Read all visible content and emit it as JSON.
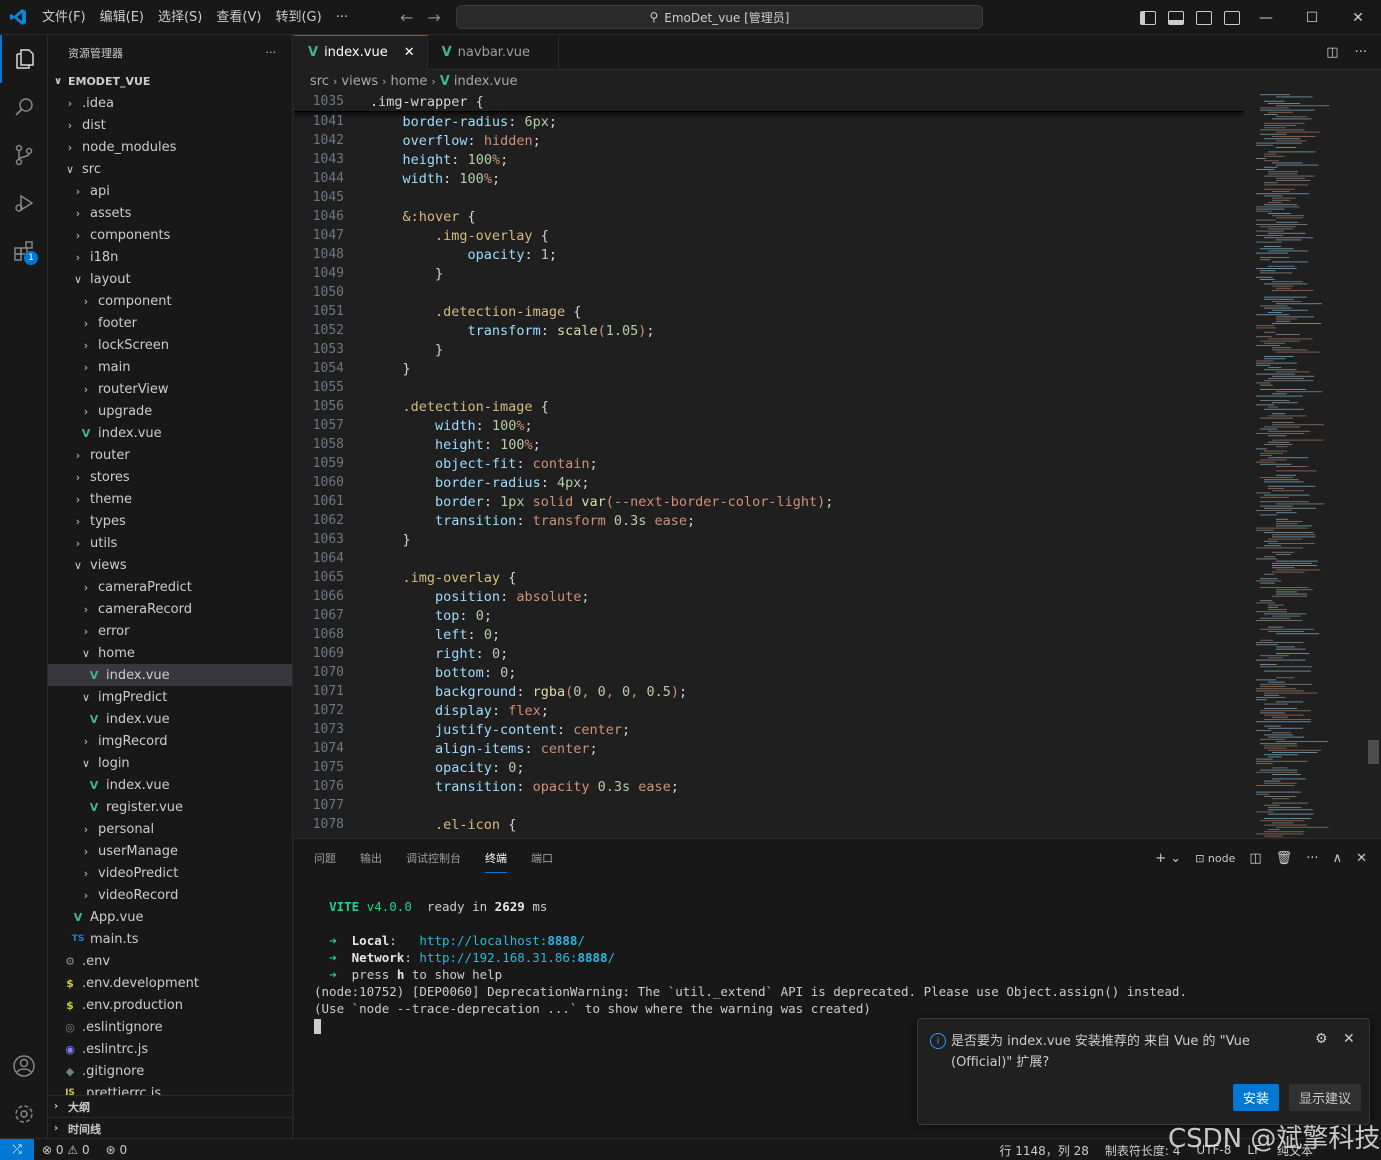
{
  "titlebar": {
    "menus": [
      "文件(F)",
      "编辑(E)",
      "选择(S)",
      "查看(V)",
      "转到(G)",
      "···"
    ],
    "command_center": "EmoDet_vue [管理员]"
  },
  "sidebar": {
    "title": "资源管理器",
    "more": "···",
    "root": "EMODET_VUE",
    "tree": [
      {
        "label": ".idea",
        "depth": 0,
        "kind": "folder",
        "open": false
      },
      {
        "label": "dist",
        "depth": 0,
        "kind": "folder",
        "open": false
      },
      {
        "label": "node_modules",
        "depth": 0,
        "kind": "folder",
        "open": false
      },
      {
        "label": "src",
        "depth": 0,
        "kind": "folder",
        "open": true
      },
      {
        "label": "api",
        "depth": 1,
        "kind": "folder",
        "open": false
      },
      {
        "label": "assets",
        "depth": 1,
        "kind": "folder",
        "open": false
      },
      {
        "label": "components",
        "depth": 1,
        "kind": "folder",
        "open": false
      },
      {
        "label": "i18n",
        "depth": 1,
        "kind": "folder",
        "open": false
      },
      {
        "label": "layout",
        "depth": 1,
        "kind": "folder",
        "open": true
      },
      {
        "label": "component",
        "depth": 2,
        "kind": "folder",
        "open": false
      },
      {
        "label": "footer",
        "depth": 2,
        "kind": "folder",
        "open": false
      },
      {
        "label": "lockScreen",
        "depth": 2,
        "kind": "folder",
        "open": false
      },
      {
        "label": "main",
        "depth": 2,
        "kind": "folder",
        "open": false
      },
      {
        "label": "routerView",
        "depth": 2,
        "kind": "folder",
        "open": false
      },
      {
        "label": "upgrade",
        "depth": 2,
        "kind": "folder",
        "open": false
      },
      {
        "label": "index.vue",
        "depth": 2,
        "kind": "vue"
      },
      {
        "label": "router",
        "depth": 1,
        "kind": "folder",
        "open": false
      },
      {
        "label": "stores",
        "depth": 1,
        "kind": "folder",
        "open": false
      },
      {
        "label": "theme",
        "depth": 1,
        "kind": "folder",
        "open": false
      },
      {
        "label": "types",
        "depth": 1,
        "kind": "folder",
        "open": false
      },
      {
        "label": "utils",
        "depth": 1,
        "kind": "folder",
        "open": false
      },
      {
        "label": "views",
        "depth": 1,
        "kind": "folder",
        "open": true
      },
      {
        "label": "cameraPredict",
        "depth": 2,
        "kind": "folder",
        "open": false
      },
      {
        "label": "cameraRecord",
        "depth": 2,
        "kind": "folder",
        "open": false
      },
      {
        "label": "error",
        "depth": 2,
        "kind": "folder",
        "open": false
      },
      {
        "label": "home",
        "depth": 2,
        "kind": "folder",
        "open": true
      },
      {
        "label": "index.vue",
        "depth": 3,
        "kind": "vue",
        "selected": true
      },
      {
        "label": "imgPredict",
        "depth": 2,
        "kind": "folder",
        "open": true
      },
      {
        "label": "index.vue",
        "depth": 3,
        "kind": "vue"
      },
      {
        "label": "imgRecord",
        "depth": 2,
        "kind": "folder",
        "open": false
      },
      {
        "label": "login",
        "depth": 2,
        "kind": "folder",
        "open": true
      },
      {
        "label": "index.vue",
        "depth": 3,
        "kind": "vue"
      },
      {
        "label": "register.vue",
        "depth": 3,
        "kind": "vue"
      },
      {
        "label": "personal",
        "depth": 2,
        "kind": "folder",
        "open": false
      },
      {
        "label": "userManage",
        "depth": 2,
        "kind": "folder",
        "open": false
      },
      {
        "label": "videoPredict",
        "depth": 2,
        "kind": "folder",
        "open": false
      },
      {
        "label": "videoRecord",
        "depth": 2,
        "kind": "folder",
        "open": false
      },
      {
        "label": "App.vue",
        "depth": 1,
        "kind": "vue"
      },
      {
        "label": "main.ts",
        "depth": 1,
        "kind": "ts"
      },
      {
        "label": ".env",
        "depth": 0,
        "kind": "gear"
      },
      {
        "label": ".env.development",
        "depth": 0,
        "kind": "dollar"
      },
      {
        "label": ".env.production",
        "depth": 0,
        "kind": "dollar"
      },
      {
        "label": ".eslintignore",
        "depth": 0,
        "kind": "eslintignore"
      },
      {
        "label": ".eslintrc.js",
        "depth": 0,
        "kind": "eslint"
      },
      {
        "label": ".gitignore",
        "depth": 0,
        "kind": "git"
      },
      {
        "label": ".prettierrc.js",
        "depth": 0,
        "kind": "js"
      }
    ],
    "outline": "大纲",
    "timeline": "时间线"
  },
  "icons": {
    "tree_file_glyphs": {
      "vue": "V",
      "ts": "TS",
      "gear": "⚙",
      "dollar": "$",
      "eslintignore": "◎",
      "eslint": "◉",
      "git": "◆",
      "js": "JS"
    }
  },
  "editor": {
    "tabs": [
      {
        "label": "index.vue",
        "active": true
      },
      {
        "label": "navbar.vue",
        "active": false
      }
    ],
    "breadcrumb": [
      "src",
      "views",
      "home",
      "index.vue"
    ],
    "sticky": {
      "num": "1035",
      "code": ".img-wrapper {"
    },
    "lines": [
      {
        "num": "1041",
        "code": "    border-radius: 6px;"
      },
      {
        "num": "1042",
        "code": "    overflow: hidden;"
      },
      {
        "num": "1043",
        "code": "    height: 100%;"
      },
      {
        "num": "1044",
        "code": "    width: 100%;"
      },
      {
        "num": "1045",
        "code": ""
      },
      {
        "num": "1046",
        "code": "    &:hover {"
      },
      {
        "num": "1047",
        "code": "        .img-overlay {"
      },
      {
        "num": "1048",
        "code": "            opacity: 1;"
      },
      {
        "num": "1049",
        "code": "        }"
      },
      {
        "num": "1050",
        "code": ""
      },
      {
        "num": "1051",
        "code": "        .detection-image {"
      },
      {
        "num": "1052",
        "code": "            transform: scale(1.05);"
      },
      {
        "num": "1053",
        "code": "        }"
      },
      {
        "num": "1054",
        "code": "    }"
      },
      {
        "num": "1055",
        "code": ""
      },
      {
        "num": "1056",
        "code": "    .detection-image {"
      },
      {
        "num": "1057",
        "code": "        width: 100%;"
      },
      {
        "num": "1058",
        "code": "        height: 100%;"
      },
      {
        "num": "1059",
        "code": "        object-fit: contain;"
      },
      {
        "num": "1060",
        "code": "        border-radius: 4px;"
      },
      {
        "num": "1061",
        "code": "        border: 1px solid var(--next-border-color-light);"
      },
      {
        "num": "1062",
        "code": "        transition: transform 0.3s ease;"
      },
      {
        "num": "1063",
        "code": "    }"
      },
      {
        "num": "1064",
        "code": ""
      },
      {
        "num": "1065",
        "code": "    .img-overlay {"
      },
      {
        "num": "1066",
        "code": "        position: absolute;"
      },
      {
        "num": "1067",
        "code": "        top: 0;"
      },
      {
        "num": "1068",
        "code": "        left: 0;"
      },
      {
        "num": "1069",
        "code": "        right: 0;"
      },
      {
        "num": "1070",
        "code": "        bottom: 0;"
      },
      {
        "num": "1071",
        "code": "        background: rgba(0, 0, 0, 0.5);"
      },
      {
        "num": "1072",
        "code": "        display: flex;"
      },
      {
        "num": "1073",
        "code": "        justify-content: center;"
      },
      {
        "num": "1074",
        "code": "        align-items: center;"
      },
      {
        "num": "1075",
        "code": "        opacity: 0;"
      },
      {
        "num": "1076",
        "code": "        transition: opacity 0.3s ease;"
      },
      {
        "num": "1077",
        "code": ""
      },
      {
        "num": "1078",
        "code": "        .el-icon {"
      }
    ]
  },
  "panel": {
    "tabs": [
      {
        "label": "问题",
        "active": false
      },
      {
        "label": "输出",
        "active": false
      },
      {
        "label": "调试控制台",
        "active": false
      },
      {
        "label": "终端",
        "active": true
      },
      {
        "label": "端口",
        "active": false
      }
    ],
    "terminal_name": "node",
    "terminal": {
      "vite_name": "VITE",
      "vite_version": "v4.0.0",
      "ready_prefix": "ready in",
      "ready_ms": "2629",
      "ready_unit": "ms",
      "local_label": "Local",
      "local_url_host": "http://localhost:",
      "local_url_port": "8888",
      "network_label": "Network",
      "network_url_host": "http://192.168.31.86:",
      "network_url_port": "8888",
      "help_pre": "press",
      "help_key": "h",
      "help_post": "to show help",
      "warn1": "(node:10752) [DEP0060] DeprecationWarning: The `util._extend` API is deprecated. Please use Object.assign() instead.",
      "warn2": "(Use `node --trace-deprecation ...` to show where the warning was created)"
    }
  },
  "notification": {
    "message": "是否要为 index.vue 安装推荐的 来自 Vue 的 \"Vue (Official)\" 扩展?",
    "install": "安装",
    "show_recommendations": "显示建议"
  },
  "statusbar": {
    "errors": "0",
    "warnings": "0",
    "ports": "0",
    "position": "行 1148，列 28",
    "indent": "制表符长度: 4",
    "encoding": "UTF-8",
    "eol": "LF",
    "language": "纯文本"
  },
  "watermark": "CSDN @斌擎科技"
}
